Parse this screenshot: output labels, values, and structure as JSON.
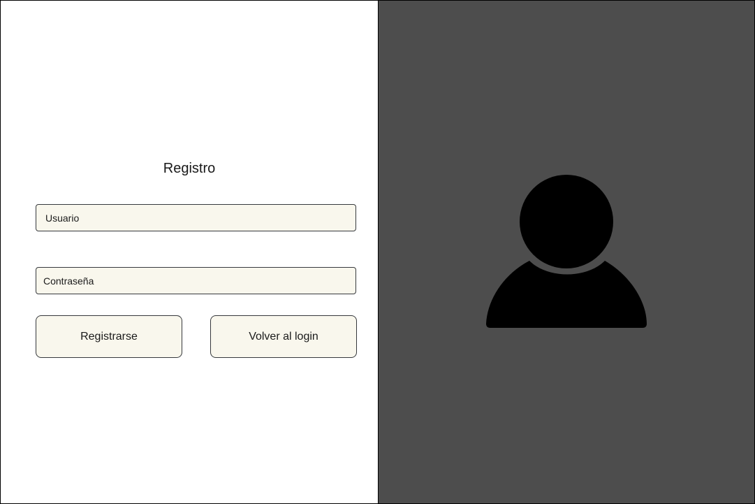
{
  "form": {
    "title": "Registro",
    "username": {
      "placeholder": "Usuario",
      "value": ""
    },
    "password": {
      "placeholder": "Contraseña",
      "value": ""
    },
    "register_label": "Registrarse",
    "back_label": "Volver al login"
  },
  "illustration": {
    "icon": "user-icon",
    "background_color": "#4d4d4d",
    "icon_color": "#000000"
  },
  "colors": {
    "field_background": "#f9f7ed",
    "field_border": "#36393d"
  }
}
